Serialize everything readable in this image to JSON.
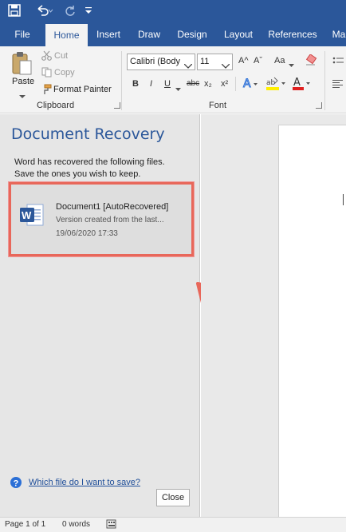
{
  "ribbon": {
    "tabs": [
      "File",
      "Home",
      "Insert",
      "Draw",
      "Design",
      "Layout",
      "References",
      "Ma"
    ],
    "clipboard": {
      "paste": "Paste",
      "cut": "Cut",
      "copy": "Copy",
      "format_painter": "Format Painter",
      "label": "Clipboard"
    },
    "font": {
      "name": "Calibri (Body",
      "size": "11",
      "label": "Font",
      "bold": "B",
      "italic": "I",
      "underline": "U",
      "strike": "abc",
      "subscript": "x₂",
      "superscript": "x²",
      "grow": "A^",
      "shrink": "Aˇ",
      "case": "Aa"
    }
  },
  "recovery": {
    "title": "Document Recovery",
    "description_line1": "Word has recovered the following files.",
    "description_line2": "Save the ones you wish to keep.",
    "file": {
      "name": "Document1  [AutoRecovered]",
      "subtitle": "Version created from the last...",
      "date": "19/06/2020 17:33"
    },
    "help_link": "Which file do I want to save?",
    "close_label": "Close"
  },
  "status": {
    "page": "Page 1 of 1",
    "words": "0 words"
  },
  "colors": {
    "brand": "#2b579a",
    "highlight_border": "#e8675a",
    "arrow": "#e8675a"
  }
}
